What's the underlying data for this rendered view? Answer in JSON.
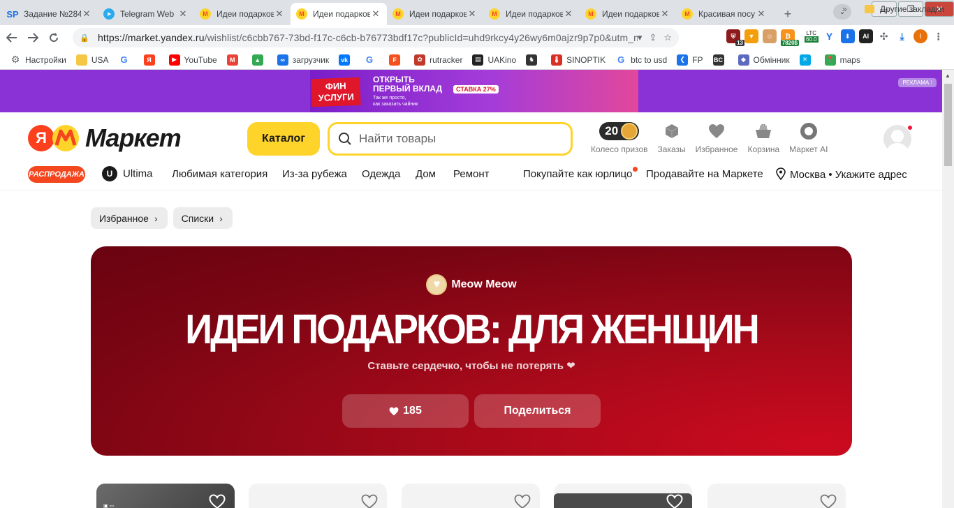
{
  "browser": {
    "tabs": [
      {
        "title": "Задание №284",
        "icon": "sp-icon",
        "color": "#1a73e8",
        "active": false
      },
      {
        "title": "Telegram Web",
        "icon": "telegram-icon",
        "color": "#2aabee",
        "active": false
      },
      {
        "title": "Идеи подарков",
        "icon": "market-icon",
        "color": "#f4461f",
        "active": false
      },
      {
        "title": "Идеи подарков",
        "icon": "market-icon",
        "color": "#f4461f",
        "active": true
      },
      {
        "title": "Идеи подарков",
        "icon": "market-icon",
        "color": "#f4461f",
        "active": false
      },
      {
        "title": "Идеи подарков",
        "icon": "market-icon",
        "color": "#f4461f",
        "active": false
      },
      {
        "title": "Идеи подарков",
        "icon": "market-icon",
        "color": "#f4461f",
        "active": false
      },
      {
        "title": "Красивая посу",
        "icon": "market-icon",
        "color": "#f4461f",
        "active": false
      }
    ],
    "url_host": "https://market.yandex.ru",
    "url_rest": "/wishlist/c6cbb767-73bd-f17c-c6cb-b76773bdf17c?publicId=uhd9rkcy4y26wy6m0ajzr9p7p0&utm_mediu...",
    "extensions": {
      "badge_13": "13",
      "ltc_label": "LTC",
      "ltc_left": "7820$",
      "ltc_value": "60.0",
      "profile_letter": "I"
    },
    "bookmarks": [
      {
        "label": "Настройки",
        "icon": "gear-icon",
        "color": "#5f6368"
      },
      {
        "label": "USA",
        "icon": "folder-icon",
        "color": "#f6c744"
      },
      {
        "label": "",
        "icon": "google-icon",
        "color": "#4285f4"
      },
      {
        "label": "",
        "icon": "yandex-icon",
        "color": "#fc3f1d"
      },
      {
        "label": "YouTube",
        "icon": "youtube-icon",
        "color": "#ff0000"
      },
      {
        "label": "",
        "icon": "gmail-icon",
        "color": "#ea4335"
      },
      {
        "label": "",
        "icon": "drive-icon",
        "color": "#34a853"
      },
      {
        "label": "загрузчик",
        "icon": "loop-icon",
        "color": "#1a73e8"
      },
      {
        "label": "",
        "icon": "vk-icon",
        "color": "#0077ff"
      },
      {
        "label": "",
        "icon": "translate-icon",
        "color": "#4285f4"
      },
      {
        "label": "",
        "icon": "f-icon",
        "color": "#f4511e"
      },
      {
        "label": "rutracker",
        "icon": "rutracker-icon",
        "color": "#c0392b"
      },
      {
        "label": "UAKino",
        "icon": "uakino-icon",
        "color": "#222222"
      },
      {
        "label": "",
        "icon": "chess-icon",
        "color": "#333333"
      },
      {
        "label": "SINOPTIK",
        "icon": "thermometer-icon",
        "color": "#d93025"
      },
      {
        "label": "btc to usd",
        "icon": "google-icon",
        "color": "#4285f4"
      },
      {
        "label": "FP",
        "icon": "fp-icon",
        "color": "#1a73e8"
      },
      {
        "label": "",
        "icon": "bc-icon",
        "color": "#333333"
      },
      {
        "label": "Обмінник",
        "icon": "exchange-icon",
        "color": "#5c6bc0"
      },
      {
        "label": "",
        "icon": "star-icon",
        "color": "#00a8e8"
      },
      {
        "label": "maps",
        "icon": "maps-icon",
        "color": "#34a853"
      }
    ],
    "bookmarks_more": "»",
    "other_bookmarks": "Другие закладки"
  },
  "ad": {
    "fin_line1": "ФИН",
    "fin_line2": "УСЛУГИ",
    "line1": "ОТКРЫТЬ",
    "line2": "ПЕРВЫЙ ВКЛАД",
    "rate": "СТАВКА 27%",
    "small1": "Так же просто,",
    "small2": "как заказать чайник",
    "label": "РЕКЛАМА ⁝"
  },
  "header": {
    "logo_ya": "Я",
    "logo_word": "Маркет",
    "catalog": "Каталог",
    "search_placeholder": "Найти товары",
    "coins_count": "20",
    "icons": [
      {
        "label": "Колесо призов",
        "name": "prize-wheel"
      },
      {
        "label": "Заказы",
        "name": "orders"
      },
      {
        "label": "Избранное",
        "name": "favorites"
      },
      {
        "label": "Корзина",
        "name": "cart"
      },
      {
        "label": "Маркет AI",
        "name": "market-ai"
      }
    ]
  },
  "nav": {
    "sale": "РАСПРОДАЖА",
    "ultima_u": "U",
    "ultima": "Ultima",
    "items": [
      "Любимая категория",
      "Из-за рубежа",
      "Одежда",
      "Дом",
      "Ремонт"
    ],
    "business": "Покупайте как юрлицо",
    "sell": "Продавайте на Маркете",
    "location": "Москва • Укажите адрес"
  },
  "breadcrumbs": [
    "Избранное",
    "Списки"
  ],
  "hero": {
    "author": "Meow Meow",
    "title": "ИДЕИ ПОДАРКОВ: ДЛЯ ЖЕНЩИН",
    "subtitle": "Ставьте сердечко, чтобы не потерять ❤",
    "likes": "185",
    "share": "Поделиться",
    "gradient_dark": "#6a0310",
    "gradient_light": "#cc0a1f"
  },
  "colors": {
    "accent_yellow": "#fed42b",
    "market_red": "#f4461f",
    "ad_purple": "#8a32d6"
  }
}
